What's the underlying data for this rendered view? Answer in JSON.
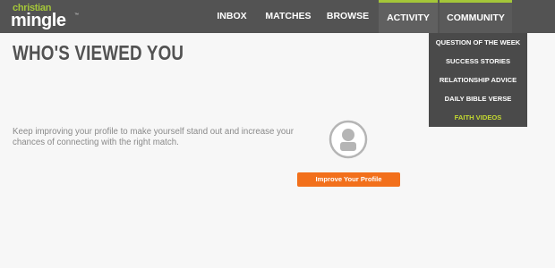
{
  "logo": {
    "line1": "christian",
    "line2": "mingle",
    "mark": "™"
  },
  "nav": {
    "inbox": "INBOX",
    "matches": "MATCHES",
    "browse": "BROWSE",
    "activity": "ACTIVITY",
    "community": "COMMUNITY"
  },
  "community_menu": {
    "items": [
      "QUESTION OF THE WEEK",
      "SUCCESS STORIES",
      "RELATIONSHIP ADVICE",
      "DAILY BIBLE VERSE",
      "FAITH VIDEOS"
    ],
    "highlighted": "FAITH VIDEOS"
  },
  "main": {
    "title": "WHO'S VIEWED YOU",
    "message": "Keep improving your profile to make yourself stand out and increase your chances of connecting with the right match.",
    "cta_label": "Improve Your Profile"
  },
  "colors": {
    "accent": "#a4c639",
    "cta": "#f2701b",
    "nav_bg": "#535353",
    "menu_highlight": "#c3d930"
  },
  "icons": {
    "avatar": "default-user-avatar-icon"
  }
}
